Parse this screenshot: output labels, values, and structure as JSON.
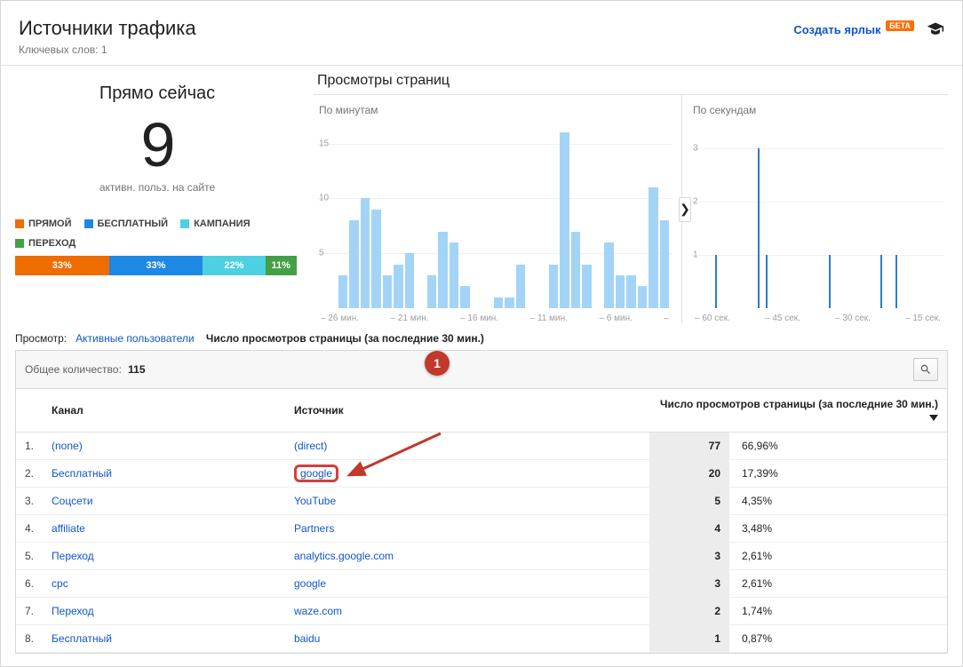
{
  "header": {
    "title": "Источники трафика",
    "subtitle_prefix": "Ключевых слов:",
    "subtitle_count": "1",
    "shortcut_link": "Создать ярлык",
    "beta": "БЕТА"
  },
  "realtime": {
    "title": "Прямо сейчас",
    "count": "9",
    "subtitle": "активн. польз. на сайте",
    "legend": [
      {
        "label": "ПРЯМОЙ",
        "color": "#ef6c00"
      },
      {
        "label": "БЕСПЛАТНЫЙ",
        "color": "#1e88e5"
      },
      {
        "label": "КАМПАНИЯ",
        "color": "#4dd0e1"
      },
      {
        "label": "ПЕРЕХОД",
        "color": "#43a047"
      }
    ],
    "distribution": [
      {
        "label": "33%",
        "color": "#ef6c00",
        "pct": 33
      },
      {
        "label": "33%",
        "color": "#1e88e5",
        "pct": 33
      },
      {
        "label": "22%",
        "color": "#4dd0e1",
        "pct": 22
      },
      {
        "label": "11%",
        "color": "#43a047",
        "pct": 11
      }
    ]
  },
  "charts": {
    "title": "Просмотры страниц",
    "minute": {
      "label": "По минутам",
      "yticks": [
        "5",
        "10",
        "15"
      ],
      "xticks": [
        "– 26 мин.",
        "– 21 мин.",
        "– 16 мин.",
        "– 11 мин.",
        "– 6 мин.",
        "–"
      ]
    },
    "second": {
      "label": "По секундам",
      "yticks": [
        "1",
        "2",
        "3"
      ],
      "xticks": [
        "– 60 сек.",
        "– 45 сек.",
        "– 30 сек.",
        "– 15 сек."
      ]
    }
  },
  "chart_data": [
    {
      "type": "bar",
      "title": "Просмотры страниц — По минутам",
      "xlabel": "минуты назад",
      "ylabel": "просмотры",
      "ylim": [
        0,
        17
      ],
      "categories": [
        "-30",
        "-29",
        "-28",
        "-27",
        "-26",
        "-25",
        "-24",
        "-23",
        "-22",
        "-21",
        "-20",
        "-19",
        "-18",
        "-17",
        "-16",
        "-15",
        "-14",
        "-13",
        "-12",
        "-11",
        "-10",
        "-9",
        "-8",
        "-7",
        "-6",
        "-5",
        "-4",
        "-3",
        "-2",
        "-1"
      ],
      "values": [
        3,
        8,
        10,
        9,
        3,
        4,
        5,
        0,
        3,
        7,
        6,
        2,
        0,
        0,
        1,
        1,
        4,
        0,
        0,
        4,
        16,
        7,
        4,
        0,
        6,
        3,
        3,
        2,
        11,
        8
      ]
    },
    {
      "type": "bar",
      "title": "Просмотры страниц — По секундам",
      "xlabel": "секунды назад",
      "ylabel": "просмотры",
      "ylim": [
        0,
        3.5
      ],
      "categories_range": "-60..-1",
      "series": [
        {
          "name": "pageviews",
          "nonzero_points": {
            "-58": 1,
            "-47": 3,
            "-45": 1,
            "-29": 1,
            "-16": 1,
            "-12": 1
          }
        }
      ]
    }
  ],
  "view": {
    "label": "Просмотр:",
    "tab_active": "Активные пользователи",
    "tab_selected": "Число просмотров страницы (за последние 30 мин.)"
  },
  "total": {
    "label": "Общее количество:",
    "value": "115"
  },
  "table": {
    "headers": {
      "channel": "Канал",
      "source": "Источник",
      "count": "Число просмотров страницы (за последние 30 мин.)"
    },
    "rows": [
      {
        "idx": "1.",
        "channel": "(none)",
        "source": "(direct)",
        "count": "77",
        "pct": "66,96%",
        "highlighted": false
      },
      {
        "idx": "2.",
        "channel": "Бесплатный",
        "source": "google",
        "count": "20",
        "pct": "17,39%",
        "highlighted": true
      },
      {
        "idx": "3.",
        "channel": "Соцсети",
        "source": "YouTube",
        "count": "5",
        "pct": "4,35%",
        "highlighted": false
      },
      {
        "idx": "4.",
        "channel": "affiliate",
        "source": "Partners",
        "count": "4",
        "pct": "3,48%",
        "highlighted": false
      },
      {
        "idx": "5.",
        "channel": "Переход",
        "source": "analytics.google.com",
        "count": "3",
        "pct": "2,61%",
        "highlighted": false
      },
      {
        "idx": "6.",
        "channel": "cpc",
        "source": "google",
        "count": "3",
        "pct": "2,61%",
        "highlighted": false
      },
      {
        "idx": "7.",
        "channel": "Переход",
        "source": "waze.com",
        "count": "2",
        "pct": "1,74%",
        "highlighted": false
      },
      {
        "idx": "8.",
        "channel": "Бесплатный",
        "source": "baidu",
        "count": "1",
        "pct": "0,87%",
        "highlighted": false
      }
    ]
  },
  "annotation": {
    "marker": "1"
  }
}
